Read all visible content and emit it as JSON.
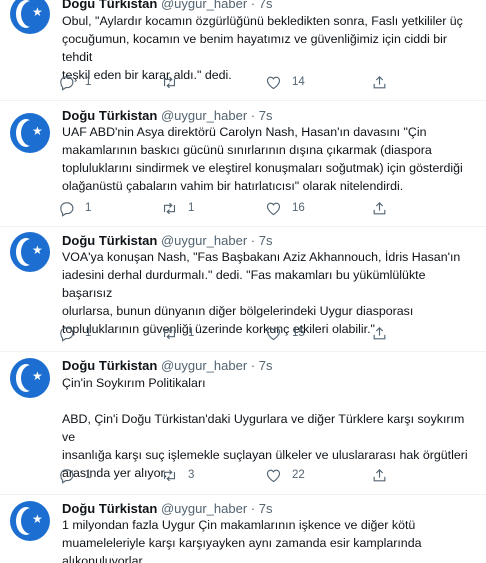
{
  "tweets": [
    {
      "name": "Doğu Türkistan",
      "handle": "@uygur_haber",
      "dot": "·",
      "time": "7s",
      "text": "Obul, \"Aylardır kocamın özgürlüğünü bekledikten sonra, Faslı yetkililer üç\nçocuğumun, kocamın ve benim hayatımız ve güvenliğimiz için ciddi bir tehdit\nteşkil eden bir karar aldı.\" dedi.",
      "replies": "1",
      "retweets": "",
      "likes": "14"
    },
    {
      "name": "Doğu Türkistan",
      "handle": "@uygur_haber",
      "dot": "·",
      "time": "7s",
      "text": "UAF ABD'nin Asya direktörü Carolyn Nash, Hasan'ın davasını \"Çin\nmakamlarının baskıcı gücünü sınırlarının dışına çıkarmak (diaspora\ntopluluklarını sindirmek ve eleştirel konuşmaları soğutmak) için gösterdiği\nolağanüstü çabaların vahim bir hatırlatıcısı\" olarak nitelendirdi.",
      "replies": "1",
      "retweets": "1",
      "likes": "16"
    },
    {
      "name": "Doğu Türkistan",
      "handle": "@uygur_haber",
      "dot": "·",
      "time": "7s",
      "text": "VOA'ya konuşan Nash, \"Fas Başbakanı Aziz Akhannouch, İdris Hasan'ın\niadesini derhal durdurmalı.\" dedi. \"Fas makamları bu yükümlülükte başarısız\nolurlarsa, bunun dünyanın diğer bölgelerindeki Uygur diasporası\ntopluluklarının güvenliği üzerinde korkunç etkileri olabilir.\"",
      "replies": "1",
      "retweets": "1",
      "likes": "15"
    },
    {
      "name": "Doğu Türkistan",
      "handle": "@uygur_haber",
      "dot": "·",
      "time": "7s",
      "text": "Çin'in Soykırım Politikaları\n\nABD, Çin'i Doğu Türkistan'daki Uygurlara ve diğer Türklere karşı soykırım ve\ninsanlığa karşı suç işlemekle suçlayan ülkeler ve uluslararası hak örgütleri\narasında yer alıyor.",
      "replies": "1",
      "retweets": "3",
      "likes": "22"
    },
    {
      "name": "Doğu Türkistan",
      "handle": "@uygur_haber",
      "dot": "·",
      "time": "7s",
      "text": "1 milyondan fazla Uygur Çin makamlarının işkence ve diğer kötü\nmuameleleriyle karşı karşıyayken aynı zamanda esir kamplarında\nalıkonuluyorlar.",
      "replies": "",
      "retweets": "",
      "likes": ""
    }
  ],
  "icons": {
    "reply": "reply-icon",
    "retweet": "retweet-icon",
    "like": "like-icon",
    "share": "share-icon",
    "avatar": "flag-avatar"
  },
  "colors": {
    "avatar_bg": "#1c6fd1",
    "secondary_text": "#536471",
    "thread_line": "#cfd9de"
  }
}
